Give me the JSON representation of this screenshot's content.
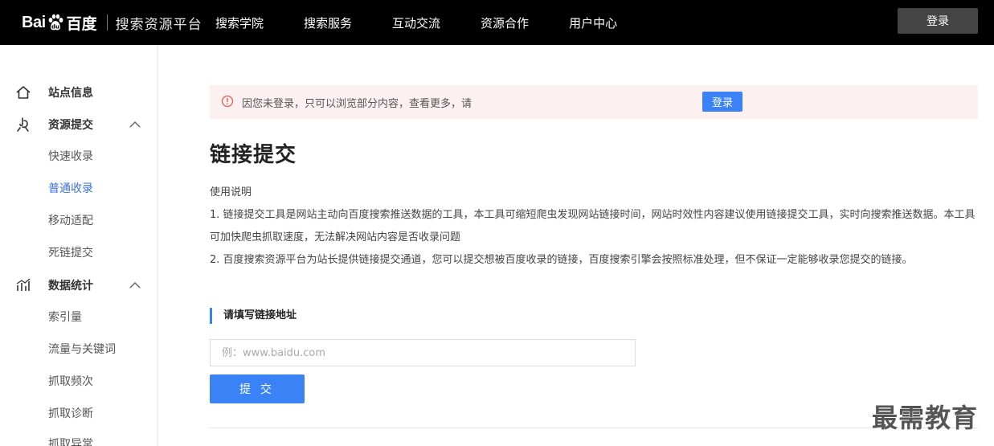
{
  "header": {
    "logo_left": "Bai",
    "logo_right": "百度",
    "logo_subtitle": "搜索资源平台",
    "nav": [
      "搜索学院",
      "搜索服务",
      "互动交流",
      "资源合作",
      "用户中心"
    ],
    "login_label": "登录"
  },
  "sidebar": {
    "groups": [
      {
        "label": "站点信息",
        "icon": "home-icon"
      },
      {
        "label": "资源提交",
        "icon": "link-submit-icon",
        "items": [
          "快速收录",
          "普通收录",
          "移动适配",
          "死链提交"
        ]
      },
      {
        "label": "数据统计",
        "icon": "chart-icon",
        "items": [
          "索引量",
          "流量与关键词",
          "抓取频次",
          "抓取诊断",
          "抓取异常"
        ]
      }
    ],
    "active_item": "普通收录"
  },
  "notice": {
    "text": "因您未登录，只可以浏览部分内容，查看更多，请",
    "button_label": "登录"
  },
  "main": {
    "title": "链接提交",
    "desc_heading": "使用说明",
    "desc_1": "1. 链接提交工具是网站主动向百度搜索推送数据的工具，本工具可缩短爬虫发现网站链接时间，网站时效性内容建议使用链接提交工具，实时向搜索推送数据。本工具可加快爬虫抓取速度，无法解决网站内容是否收录问题",
    "desc_2": "2. 百度搜索资源平台为站长提供链接提交通道，您可以提交想被百度收录的链接，百度搜索引擎会按照标准处理，但不保证一定能够收录您提交的链接。",
    "section_label": "请填写链接地址",
    "input_placeholder": "例：www.baidu.com",
    "input_value": "",
    "submit_label": "提 交"
  },
  "watermark": "最需教育",
  "colors": {
    "accent": "#3b82f6",
    "active_text": "#3b71d8",
    "topbar": "#000000",
    "notice_bg": "#fdf0f0"
  }
}
